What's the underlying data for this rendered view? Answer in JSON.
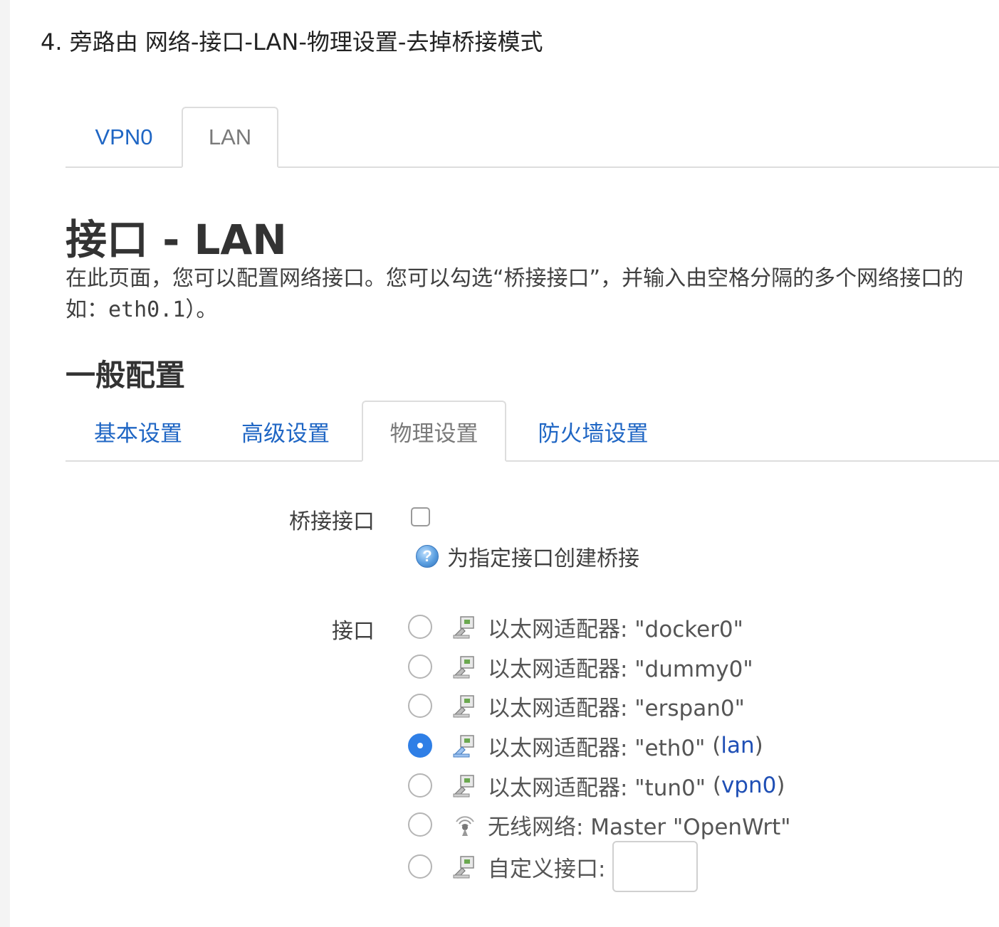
{
  "step_heading": "4. 旁路由 网络-接口-LAN-物理设置-去掉桥接模式",
  "top_tabs": [
    {
      "label": "VPN0",
      "active": false
    },
    {
      "label": "LAN",
      "active": true
    }
  ],
  "page_title": "接口 - LAN",
  "description": {
    "line1": "在此页面，您可以配置网络接口。您可以勾选“桥接接口”，并输入由空格分隔的多个网络接口的",
    "line2_prefix": "如：",
    "line2_code": "eth0.1",
    "line2_suffix": "）。"
  },
  "section_title": "一般配置",
  "sub_tabs": [
    {
      "label": "基本设置",
      "active": false
    },
    {
      "label": "高级设置",
      "active": false
    },
    {
      "label": "物理设置",
      "active": true
    },
    {
      "label": "防火墙设置",
      "active": false
    }
  ],
  "bridge": {
    "label": "桥接接口",
    "checked": false,
    "help_text": "为指定接口创建桥接",
    "help_icon": "question-icon"
  },
  "interface": {
    "label": "接口",
    "options": [
      {
        "text": "以太网适配器: \"docker0\"",
        "link": "",
        "checked": false,
        "icon": "ethernet-icon"
      },
      {
        "text": "以太网适配器: \"dummy0\"",
        "link": "",
        "checked": false,
        "icon": "ethernet-icon"
      },
      {
        "text": "以太网适配器: \"erspan0\"",
        "link": "",
        "checked": false,
        "icon": "ethernet-icon"
      },
      {
        "text": "以太网适配器: \"eth0\"",
        "link": "lan",
        "checked": true,
        "icon": "ethernet-icon"
      },
      {
        "text": "以太网适配器: \"tun0\"",
        "link": "vpn0",
        "checked": false,
        "icon": "ethernet-icon"
      },
      {
        "text": "无线网络: Master \"OpenWrt\"",
        "link": "",
        "checked": false,
        "icon": "wireless-icon"
      },
      {
        "text": "自定义接口:",
        "link": "",
        "checked": false,
        "icon": "ethernet-icon",
        "custom_value": ""
      }
    ]
  },
  "colors": {
    "link": "#1f66c4",
    "radio_checked": "#2f7fe6",
    "border": "#dddddd"
  }
}
